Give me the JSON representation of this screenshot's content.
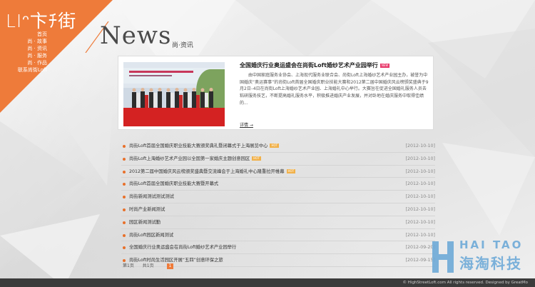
{
  "brand": {
    "logo_text": "LIᵔ卞ﾁ街",
    "accent_color": "#ee7b3a"
  },
  "nav": {
    "items": [
      {
        "label": "首页"
      },
      {
        "label": "尚 · 故事"
      },
      {
        "label": "尚 · 资讯"
      },
      {
        "label": "尚 · 服务"
      },
      {
        "label": "尚 · 作品"
      },
      {
        "label": "联系尚街Loft"
      }
    ]
  },
  "header": {
    "title": "News",
    "subtitle": "尚·资讯"
  },
  "featured": {
    "title": "全国婚庆行业奥运盛会在尚街Loft婚纱艺术产业园举行",
    "tag": "NEW",
    "body": "由中国家庭服务业协会、上海现代服务业联合会、尚街Loft上海婚纱艺术产业园主办，被誉为中国婚庆“奥运赛事”的尚街Loft首届全国婚庆职业技能大赛和2012第二届中国婚庆风云榜颁奖盛典于9月2日–4日在尚街Loft上海婚纱艺术产业园、上海婚礼中心举行。大赛旨在促进全国婚礼服务人员去粘研服务技艺，不断提高婚礼服务水平，积极推进婚庆产业发展，并对卧地在婚庆服务中取得佳绩的...",
    "more_label": "详情 →"
  },
  "news_list": [
    {
      "title": "尚街Loft首届全国婚庆职业技能大赛颁奖典礼暨闭幕式于上海展览中心",
      "badge": "HOT",
      "date": "[2012-10-10]"
    },
    {
      "title": "尚街Loft上海婚纱艺术产业园以全国第一家婚庆主题创意园区",
      "badge": "HOT",
      "date": "[2012-10-10]"
    },
    {
      "title": "2012第二届中国婚庆风云榜颁奖盛典暨交流峰会于上海婚礼中心隆重拉开帷幕",
      "badge": "HOT",
      "date": "[2012-10-10]"
    },
    {
      "title": "尚街Loft首届全国婚庆职业技能大赛暨开幕式",
      "badge": "",
      "date": "[2012-10-10]"
    },
    {
      "title": "尚街新闻测试测试测试",
      "badge": "",
      "date": "[2012-10-10]"
    },
    {
      "title": "时尚产业新闻测试",
      "badge": "",
      "date": "[2012-10-10]"
    },
    {
      "title": "园区新闻测试勤",
      "badge": "",
      "date": "[2012-10-10]"
    },
    {
      "title": "尚街Loft园区新闻测试",
      "badge": "",
      "date": "[2012-10-10]"
    },
    {
      "title": "全国婚庆行业奥运盛会在尚街Loft婚纱艺术产业园举行",
      "badge": "",
      "date": "[2012-09-20]"
    },
    {
      "title": "尚街Loft时尚生活园区开展“五四”创意环保之旅",
      "badge": "",
      "date": "[2012-09-15]"
    }
  ],
  "pager": {
    "page_label": "第1页",
    "total_label": "共1页",
    "current": "1"
  },
  "footer": {
    "copyright": "© HighStreetLoft.com All rights reserved. Designed by GreatMo"
  },
  "watermark": {
    "en": "HAI TAO",
    "cn": "海淘科技"
  }
}
